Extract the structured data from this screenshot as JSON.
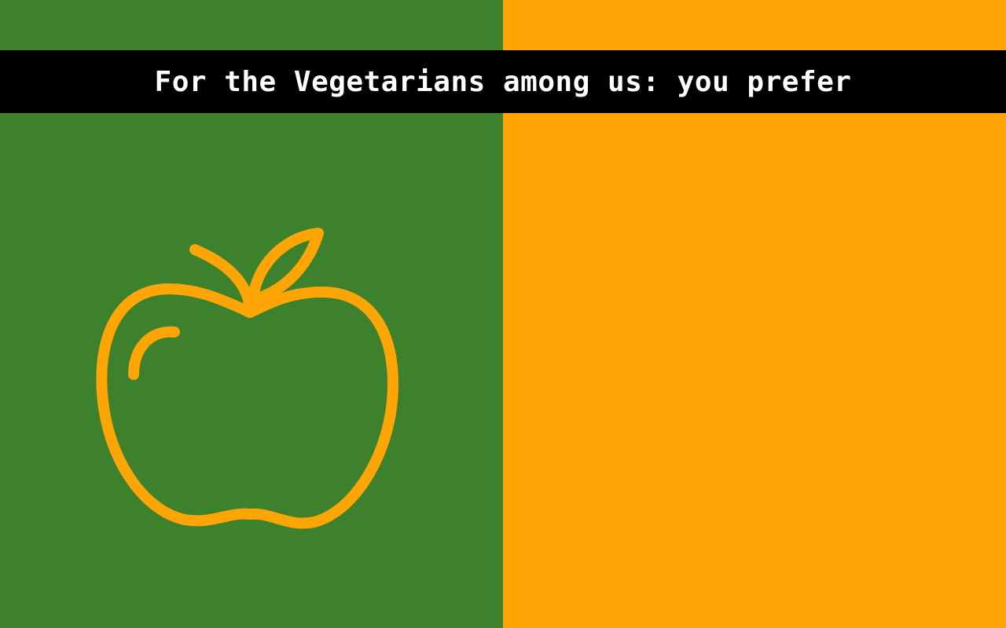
{
  "title": "For the Vegetarians among us: you prefer",
  "options": [
    {
      "icon": "apple-icon",
      "background": "#3e812c",
      "stroke": "#ffa505"
    },
    {
      "icon": "orange-icon",
      "background": "#ffa505",
      "stroke": "#3e812c"
    }
  ]
}
